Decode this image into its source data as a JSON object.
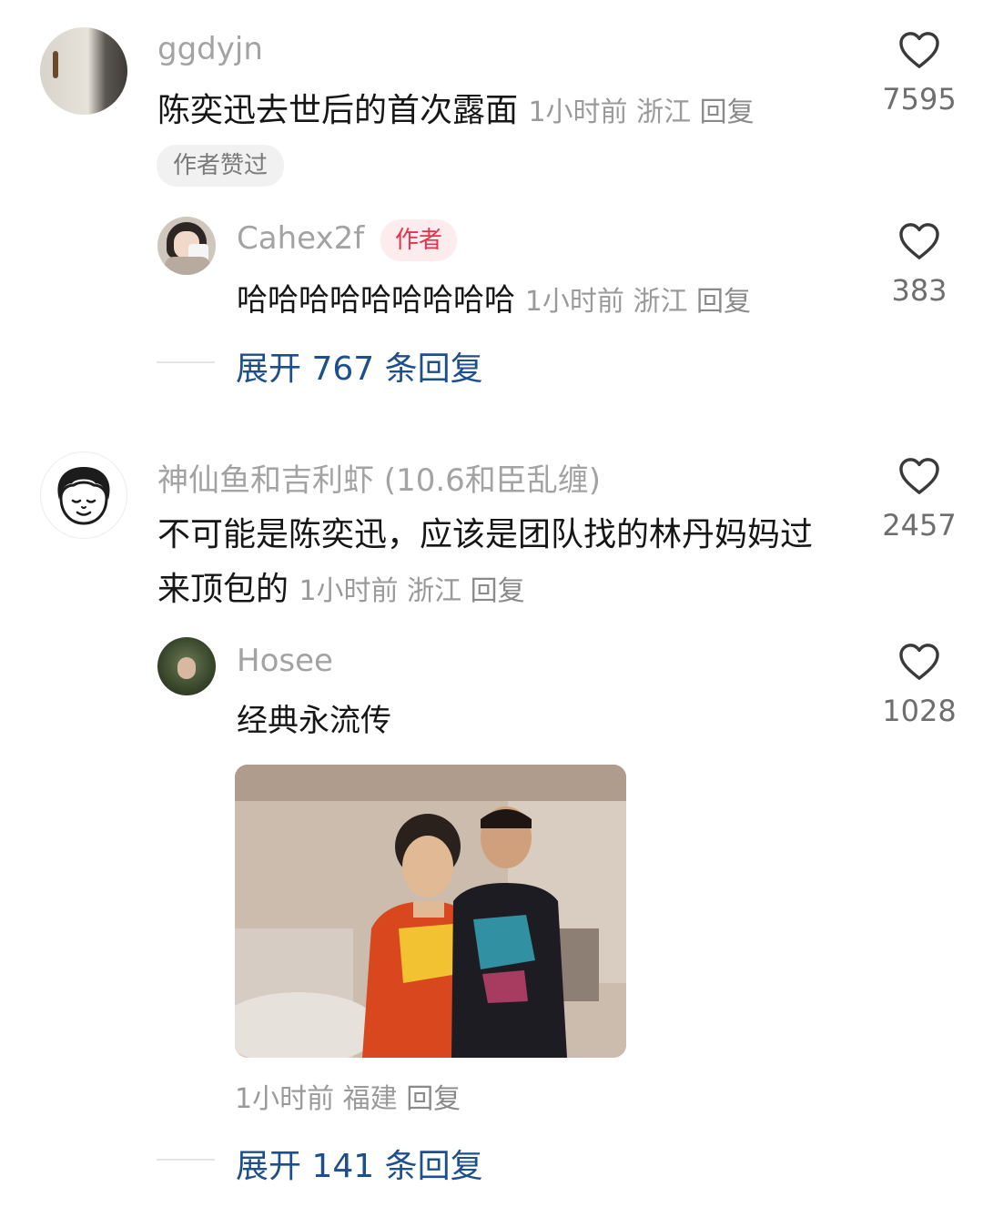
{
  "comments": [
    {
      "username": "ggdyjn",
      "text": "陈奕迅去世后的首次露面",
      "time": "1小时前",
      "location": "浙江",
      "reply_label": "回复",
      "likes": "7595",
      "author_liked_badge": "作者赞过",
      "reply": {
        "username": "Cahex2f",
        "author_badge": "作者",
        "text": "哈哈哈哈哈哈哈哈哈",
        "time": "1小时前",
        "location": "浙江",
        "reply_label": "回复",
        "likes": "383"
      },
      "expand_label": "展开 767 条回复"
    },
    {
      "username": "神仙鱼和吉利虾 (10.6和臣乱缠)",
      "text_line1": "不可能是陈奕迅，应该是团队找的林丹妈妈过",
      "text_line2": "来顶包的",
      "time": "1小时前",
      "location": "浙江",
      "reply_label": "回复",
      "likes": "2457",
      "reply": {
        "username": "Hosee",
        "text": "经典永流传",
        "time": "1小时前",
        "location": "福建",
        "reply_label": "回复",
        "likes": "1028"
      },
      "expand_label": "展开 141 条回复"
    }
  ],
  "icons": {
    "like": "heart-outline-icon"
  },
  "colors": {
    "expand_link": "#1d4f8c",
    "author_badge_text": "#e8324a",
    "author_badge_bg": "#fdecee",
    "username": "#a3a3a3",
    "meta": "#9a9a9a"
  }
}
